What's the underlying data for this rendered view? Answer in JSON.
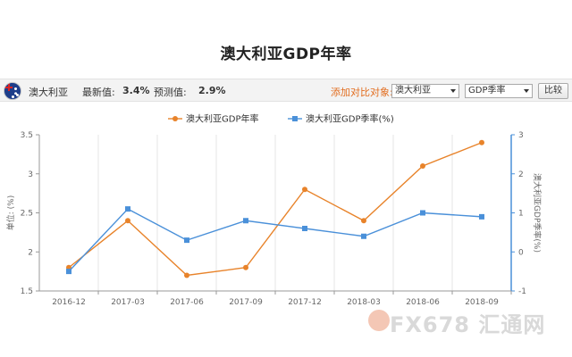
{
  "page": {
    "title": "澳大利亚GDP年率"
  },
  "info_bar": {
    "country": "澳大利亚",
    "latest_label": "最新值:",
    "latest_value": "3.4%",
    "forecast_label": "预测值:",
    "forecast_value": "2.9%",
    "compare_label": "添加对比对象:",
    "select_country": "澳大利亚",
    "select_indicator": "GDP季率",
    "compare_button": "比较",
    "flag_icon": "australia-flag-icon"
  },
  "watermark": {
    "text": "FX678 汇通网"
  },
  "chart_data": {
    "type": "line",
    "categories": [
      "2016-12",
      "2017-03",
      "2017-06",
      "2017-09",
      "2017-12",
      "2018-03",
      "2018-06",
      "2018-09"
    ],
    "series": [
      {
        "name": "澳大利亚GDP年率",
        "axis": "left",
        "color": "#e8832a",
        "marker": "circle",
        "values": [
          1.8,
          2.4,
          1.7,
          1.8,
          2.8,
          2.4,
          3.1,
          3.4
        ]
      },
      {
        "name": "澳大利亚GDP季率(%)",
        "axis": "right",
        "color": "#4a90d9",
        "marker": "square",
        "values": [
          -0.5,
          1.1,
          0.3,
          0.8,
          0.6,
          0.4,
          1.0,
          0.9
        ]
      }
    ],
    "ylabel": "单位: (%)",
    "y2label": "澳大利亚GDP季率(%)",
    "ylim": [
      1.5,
      3.5
    ],
    "yticks": [
      "3.5",
      "3",
      "2.5",
      "2",
      "1.5"
    ],
    "y2lim": [
      -1,
      3
    ],
    "y2ticks": [
      "3",
      "2",
      "1",
      "0",
      "-1"
    ],
    "grid": "vertical",
    "legend_position": "top-center"
  }
}
